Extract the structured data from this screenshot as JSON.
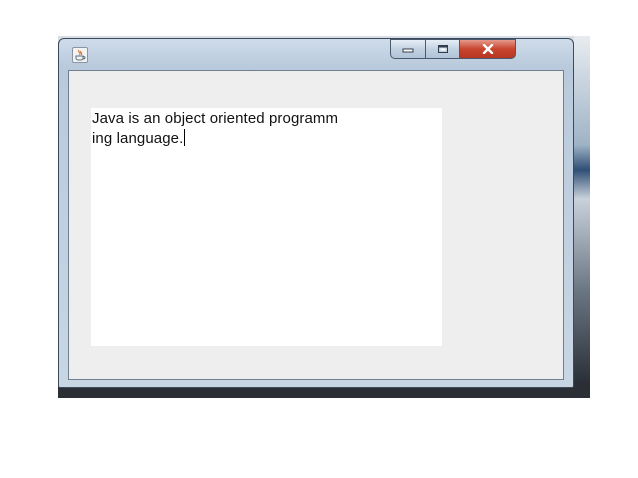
{
  "window": {
    "title": "",
    "controls": {
      "minimize_icon": "minimize-icon",
      "maximize_icon": "maximize-icon",
      "close_icon": "close-icon"
    },
    "app_icon": "java-cup-icon"
  },
  "text_area": {
    "lines": [
      "Java is an object oriented programm",
      "ing language."
    ]
  },
  "colors": {
    "close_button": "#c9452f",
    "client_background": "#eeeeee",
    "text_area_background": "#ffffff"
  }
}
